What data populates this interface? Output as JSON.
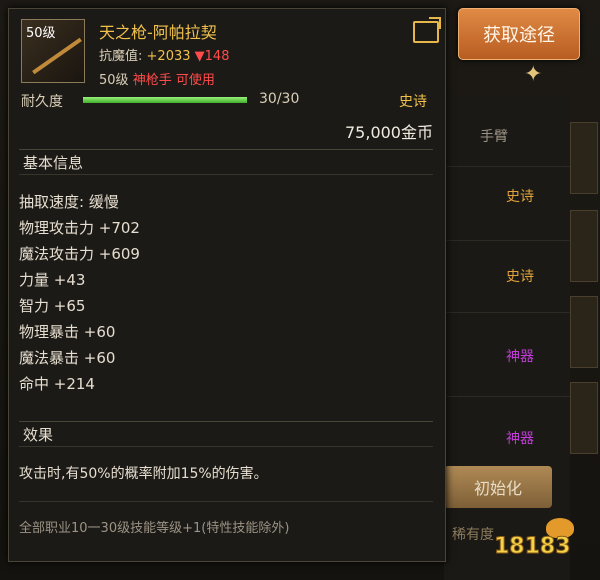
{
  "item": {
    "level_badge": "50级",
    "name": "天之枪-阿帕拉契",
    "resist_label": "抗魔值:",
    "resist_value": "+2033",
    "resist_delta": "▼148",
    "requirement_level": "50级",
    "requirement_class": "神枪手 可使用",
    "durability_label": "耐久度",
    "durability_value": "30/30",
    "durability_fraction": 1.0,
    "rarity": "史诗",
    "price": "75,000金币"
  },
  "basic_info": {
    "title": "基本信息",
    "stats": [
      "抽取速度: 缓慢",
      "物理攻击力 +702",
      "魔法攻击力 +609",
      "力量 +43",
      "智力 +65",
      "物理暴击 +60",
      "魔法暴击 +60",
      "命中 +214"
    ]
  },
  "effect": {
    "title": "效果",
    "text": "攻击时,有50%的概率附加15%的伤害。",
    "skill": "全部职业10一30级技能等级+1(特性技能除外)"
  },
  "toolbar": {
    "acquire_label": "获取途径"
  },
  "background": {
    "arm_label": "手臂",
    "tags": [
      "史诗",
      "史诗",
      "神器",
      "神器"
    ],
    "init_button": "初始化",
    "rare_label": "稀有度",
    "colors": {
      "epic": "#e0a23a",
      "artifact": "#c23cd8"
    }
  },
  "watermark": {
    "text": "18183"
  },
  "colors": {
    "gold": "#f1c14b",
    "red": "#ff4b4b",
    "text": "#e6ded0"
  }
}
